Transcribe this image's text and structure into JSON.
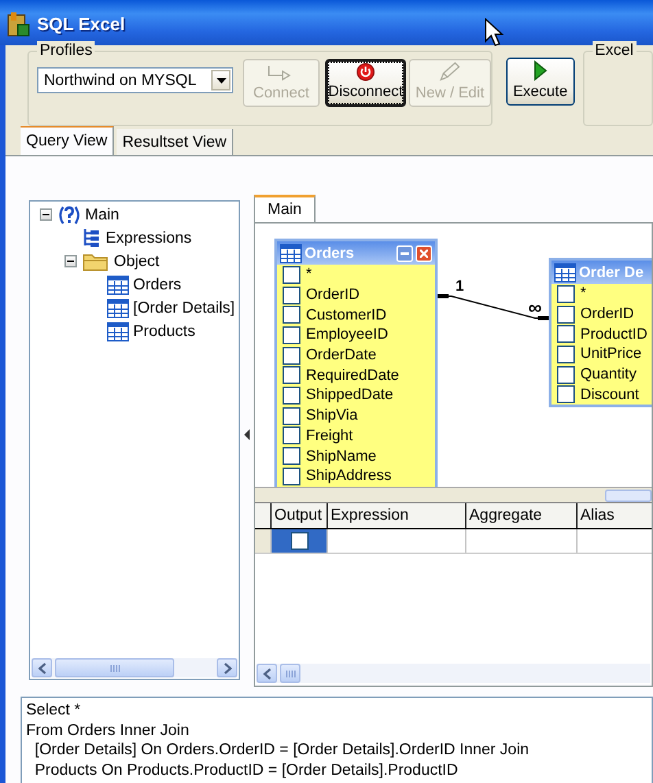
{
  "window": {
    "title": "SQL Excel"
  },
  "profiles": {
    "label": "Profiles",
    "selected_profile": "Northwind on MYSQL"
  },
  "toolbar_buttons": [
    {
      "label": "Connect",
      "kind": "connect",
      "disabled": true,
      "focused": false
    },
    {
      "label": "Disconnect",
      "kind": "disconnect",
      "disabled": false,
      "focused": true
    },
    {
      "label": "New / Edit",
      "kind": "edit",
      "disabled": true,
      "focused": false
    }
  ],
  "execute_button": {
    "label": "Execute"
  },
  "excel_group": {
    "label": "Excel"
  },
  "view_tabs": [
    {
      "label": "Query View",
      "selected": true
    },
    {
      "label": "Resultset View",
      "selected": false
    }
  ],
  "tree": [
    {
      "label": "Main",
      "kind": "query",
      "expanded": true,
      "children": [
        {
          "label": "Expressions",
          "kind": "expressions"
        },
        {
          "label": "Object",
          "kind": "folder",
          "expanded": true,
          "children": [
            {
              "label": "Orders",
              "kind": "table"
            },
            {
              "label": "[Order Details]",
              "kind": "table"
            },
            {
              "label": "Products",
              "kind": "table"
            }
          ]
        }
      ]
    }
  ],
  "designer_tabs": [
    {
      "label": "Main",
      "selected": true
    }
  ],
  "diagram": {
    "tables": [
      {
        "title": "Orders",
        "fields": [
          {
            "name": "*",
            "checked": false
          },
          {
            "name": "OrderID",
            "checked": false
          },
          {
            "name": "CustomerID",
            "checked": false
          },
          {
            "name": "EmployeeID",
            "checked": false
          },
          {
            "name": "OrderDate",
            "checked": false
          },
          {
            "name": "RequiredDate",
            "checked": false
          },
          {
            "name": "ShippedDate",
            "checked": false
          },
          {
            "name": "ShipVia",
            "checked": false
          },
          {
            "name": "Freight",
            "checked": false
          },
          {
            "name": "ShipName",
            "checked": false
          },
          {
            "name": "ShipAddress",
            "checked": false
          }
        ]
      },
      {
        "title": "Order De",
        "fields": [
          {
            "name": "*",
            "checked": false
          },
          {
            "name": "OrderID",
            "checked": false
          },
          {
            "name": "ProductID",
            "checked": false
          },
          {
            "name": "UnitPrice",
            "checked": false
          },
          {
            "name": "Quantity",
            "checked": false
          },
          {
            "name": "Discount",
            "checked": false
          }
        ]
      }
    ],
    "relations": [
      {
        "from_label": "1",
        "to_label": "∞"
      }
    ]
  },
  "grid": {
    "columns": [
      "Output",
      "Expression",
      "Aggregate",
      "Alias"
    ],
    "rows": [
      {
        "selected": true,
        "output": false
      }
    ]
  },
  "sql": [
    "Select *",
    "From Orders Inner Join",
    "  [Order Details] On Orders.OrderID = [Order Details].OrderID Inner Join",
    "  Products On Products.ProductID = [Order Details].ProductID"
  ]
}
